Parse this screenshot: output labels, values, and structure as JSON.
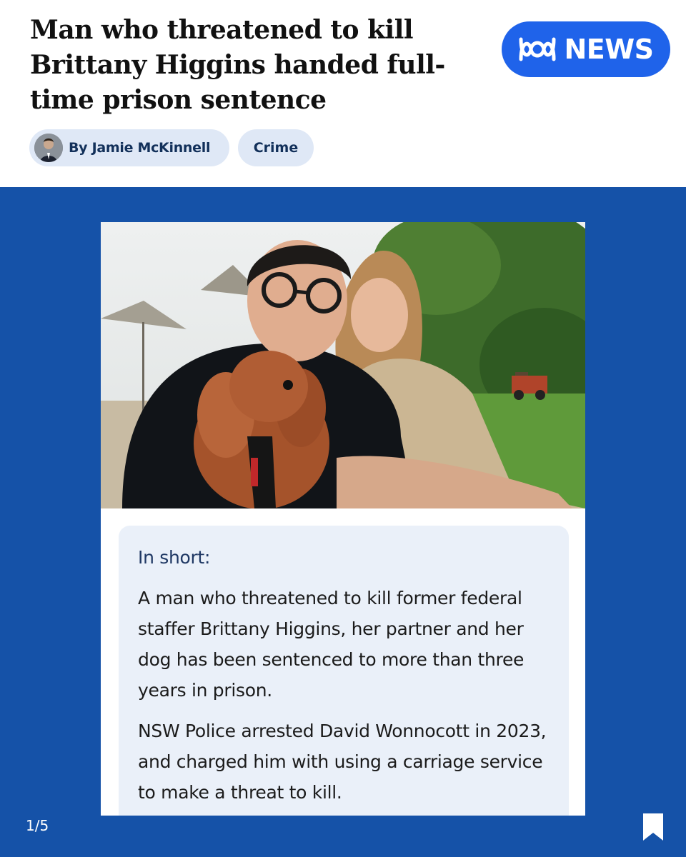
{
  "article": {
    "headline": "Man who threatened to kill Brittany Higgins handed full-time prison sentence",
    "byline": "By Jamie McKinnell",
    "tag": "Crime"
  },
  "brand": {
    "name": "NEWS",
    "badge_color": "#1f63ea",
    "logo_icon": "abc-lissajous-icon"
  },
  "summary": {
    "title": "In short:",
    "paragraphs": [
      "A man who threatened to kill former federal staffer Brittany Higgins, her partner and her dog has been sentenced to more than three years in prison.",
      "NSW Police arrested David Wonnocott in 2023, and charged him with using a carriage service to make a threat to kill."
    ]
  },
  "slides": {
    "indicator": "1/5",
    "bookmark_icon": "bookmark-icon"
  },
  "colors": {
    "background_blue": "#1552a8",
    "pill_background": "#dfe8f6",
    "summary_background": "#eaf0f9"
  }
}
